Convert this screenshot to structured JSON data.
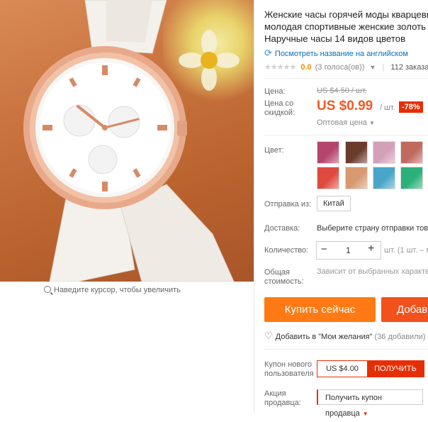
{
  "image": {
    "zoom_hint": "Наведите курсор, чтобы увеличить"
  },
  "product": {
    "title_lines": [
      "Женские часы горячей моды кварцевые",
      "молодая спортивные женские золоть",
      "Наручные часы 14 видов цветов"
    ],
    "translate_link": "Посмотреть название на английском",
    "rating": {
      "score": "0.0",
      "votes": "(3 голоса(ов))",
      "orders": "112 заказа"
    }
  },
  "pricing": {
    "price_label": "Цена:",
    "old_price": "US $4.50 / шт.",
    "discount_label": "Цена со скидкой:",
    "price": "US $0.99",
    "per": "/ шт.",
    "discount": "-78%",
    "wholesale": "Оптовая цена"
  },
  "options": {
    "color_label": "Цвет:",
    "swatch_colors": [
      "#b6456d",
      "#6b3b2c",
      "#d4a0b9",
      "#c06a5e",
      "#e04a3e",
      "#d79a70",
      "#4aa6c8",
      "#2bb07a"
    ],
    "ship_from_label": "Отправка из:",
    "ship_from": "Китай",
    "delivery_label": "Доставка:",
    "delivery_value": "Выберите страну отправки това",
    "qty_label": "Количество:",
    "qty": "1",
    "qty_minus": "−",
    "qty_plus": "+",
    "qty_unit": "шт. (1 шт. – м",
    "total_label": "Общая стоимость:",
    "total_value": "Зависит от выбранных характе"
  },
  "actions": {
    "buy_now": "Купить сейчас",
    "add_to_cart": "Добав",
    "wishlist": "Добавить в \"Мои желания\"",
    "wishlist_count": "(36 добавили)"
  },
  "coupons": {
    "new_user_label": "Купон нового пользователя",
    "new_user_amount": "US $4.00",
    "get_label": "ПОЛУЧИТЬ",
    "seller_label": "Акция продавца:",
    "seller_button": "Получить купон продавца"
  }
}
